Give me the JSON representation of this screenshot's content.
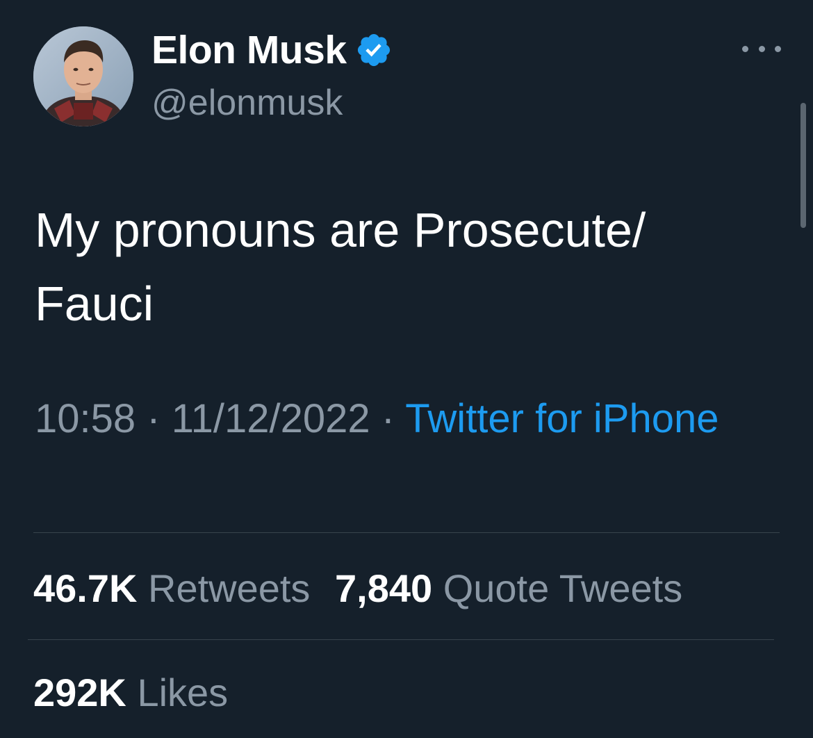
{
  "author": {
    "display_name": "Elon Musk",
    "handle": "@elonmusk",
    "avatar_icon": "profile-photo",
    "verified_icon": "verified-badge-icon",
    "verified_color": "#1d9bf0"
  },
  "tweet": {
    "text": "My pronouns are Prosecute/\nFauci"
  },
  "meta": {
    "time": "10:58",
    "separator": " · ",
    "date": "11/12/2022",
    "source": "Twitter for iPhone"
  },
  "stats": {
    "retweets": {
      "count": "46.7K",
      "label": "Retweets"
    },
    "quote_tweets": {
      "count": "7,840",
      "label": "Quote Tweets"
    },
    "likes": {
      "count": "292K",
      "label": "Likes"
    }
  },
  "colors": {
    "background": "#15202b",
    "text_primary": "#ffffff",
    "text_secondary": "#8b98a5",
    "link": "#1d9bf0",
    "divider": "#38444d"
  },
  "icons": {
    "more": "more-horizontal-icon"
  }
}
